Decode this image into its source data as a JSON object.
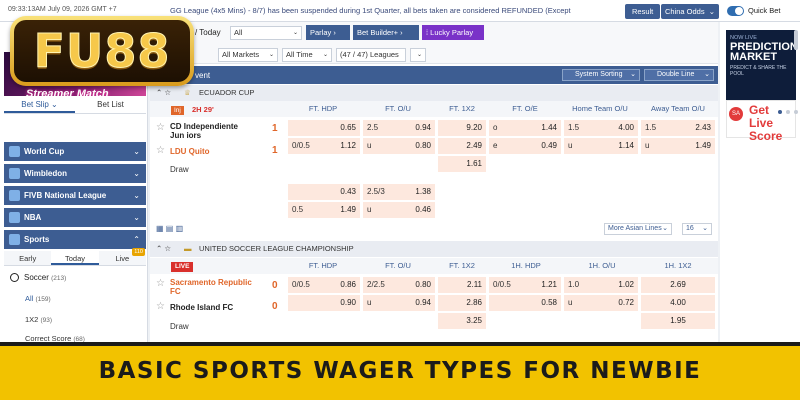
{
  "topbar": {
    "datetime": "09:33:13AM July 09, 2026 GMT +7",
    "ticker": "GG League (4x5 Mins) - 8/7) has been suspended during 1st Quarter, all bets taken are considered REFUNDED (Except",
    "result_label": "Result",
    "odds_format": "China Odds",
    "quickbet_label": "Quick Bet",
    "quickbet_on": true
  },
  "logo": {
    "text": "FU88"
  },
  "sidebar": {
    "promo_text": "Streamer Match",
    "slip_tabs": [
      "Bet Slip",
      "Bet List"
    ],
    "sections": [
      {
        "label": "World Cup"
      },
      {
        "label": "Wimbledon"
      },
      {
        "label": "FIVB National League"
      },
      {
        "label": "NBA"
      },
      {
        "label": "Sports"
      }
    ],
    "sports_tabs": [
      "Early",
      "Today",
      "Live"
    ],
    "live_count": "110",
    "soccer": {
      "label": "Soccer",
      "count": "(213)"
    },
    "sub_items": [
      {
        "label": "All",
        "count": "(159)"
      },
      {
        "label": "1X2",
        "count": "(93)"
      },
      {
        "label": "Correct Score",
        "count": "(68)"
      }
    ]
  },
  "filters": {
    "today_label": "/ Today",
    "all_select": "All",
    "markets_select": "All Markets",
    "time_select": "All Time",
    "leagues_count": "(47 / 47) Leagues",
    "mode_parlay": "Parlay",
    "mode_bet_builder": "Bet Builder+",
    "mode_lucky": "Lucky Parlay"
  },
  "event_header": {
    "label": "vent",
    "sort_label": "System Sorting",
    "line_label": "Double Line"
  },
  "league1": {
    "name": "ECUADOR CUP",
    "columns": [
      "FT. HDP",
      "FT. O/U",
      "FT. 1X2",
      "FT. O/E",
      "Home Team O/U",
      "Away Team O/U"
    ],
    "status": {
      "inj": "Inj",
      "clock": "2H 29'"
    },
    "home": {
      "name": "CD Independiente Jun iors",
      "score": "1"
    },
    "away": {
      "name": "LDU Quito",
      "score": "1"
    },
    "draw_label": "Draw",
    "row1": {
      "hdp_odd": "0.65",
      "ou_line": "2.5",
      "ou_odd": "0.94",
      "x1x2": "9.20",
      "oe_lbl": "o",
      "oe_odd": "1.44",
      "htou_line": "1.5",
      "htou_odd": "4.00",
      "atou_line": "1.5",
      "atou_odd": "2.43"
    },
    "row2": {
      "hdp_line": "0/0.5",
      "hdp_odd": "1.12",
      "ou_line": "u",
      "ou_odd": "0.80",
      "x1x2": "2.49",
      "oe_lbl": "e",
      "oe_odd": "0.49",
      "htou_line": "u",
      "htou_odd": "1.14",
      "atou_line": "u",
      "atou_odd": "1.49"
    },
    "row3": {
      "x1x2": "1.61"
    },
    "alt1": {
      "hdp_odd": "0.43",
      "ou_line": "2.5/3",
      "ou_odd": "1.38"
    },
    "alt2": {
      "hdp_line": "0.5",
      "hdp_odd": "1.49",
      "ou_line": "u",
      "ou_odd": "0.46"
    }
  },
  "more_row": {
    "more_label": "More Asian Lines",
    "count": "16"
  },
  "league2": {
    "name": "UNITED SOCCER LEAGUE CHAMPIONSHIP",
    "columns": [
      "FT. HDP",
      "FT. O/U",
      "FT. 1X2",
      "1H. HDP",
      "1H. O/U",
      "1H. 1X2"
    ],
    "live_tag": "LIVE",
    "home": {
      "name": "Sacramento Republic FC",
      "score": "0"
    },
    "away": {
      "name": "Rhode Island FC",
      "score": "0"
    },
    "draw_label": "Draw",
    "row1": {
      "hdp_line": "0/0.5",
      "hdp_odd": "0.86",
      "ou_line": "2/2.5",
      "ou_odd": "0.80",
      "x1x2": "2.11",
      "h1hdp_line": "0/0.5",
      "h1hdp_odd": "1.21",
      "h1ou_line": "1.0",
      "h1ou_odd": "1.02",
      "h1x2": "2.69"
    },
    "row2": {
      "hdp_odd": "0.90",
      "ou_line": "u",
      "ou_odd": "0.94",
      "x1x2": "2.86",
      "h1hdp_odd": "0.58",
      "h1ou_line": "u",
      "h1ou_odd": "0.72",
      "h1x2": "4.00"
    },
    "row3": {
      "x1x2": "3.25",
      "h1x2": "1.95"
    }
  },
  "right": {
    "pm_new": "NOW LIVE",
    "pm_title": "PREDICTION MARKET",
    "pm_sub": "PREDICT & SHARE THE POOL",
    "ls_badge": "SA",
    "ls_text": "Get Live Score"
  },
  "banner": {
    "title": "BASIC SPORTS WAGER TYPES FOR NEWBIE"
  },
  "colors": {
    "primary": "#3d5d92",
    "odds_cell": "#fde8de",
    "accent_orange": "#e0662a",
    "banner_yellow": "#f2c200"
  }
}
